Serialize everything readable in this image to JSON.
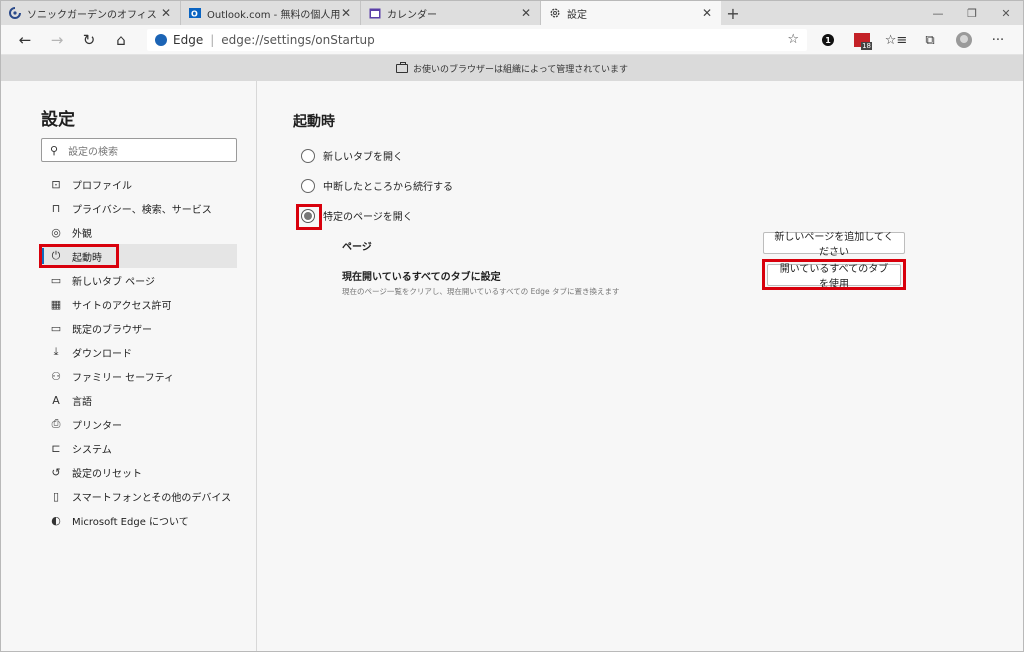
{
  "tabs": [
    {
      "title": "ソニックガーデンのオフィス",
      "favicon": "remotty-icon"
    },
    {
      "title": "Outlook.com - 無料の個人用メール",
      "favicon": "outlook-icon"
    },
    {
      "title": "カレンダー",
      "favicon": "calendar-icon"
    },
    {
      "title": "設定",
      "favicon": "gear-icon"
    }
  ],
  "address_bar": {
    "site_label": "Edge",
    "url": "edge://settings/onStartup"
  },
  "toolbar_badges": {
    "notification_count": "1",
    "calendar_day": "18"
  },
  "managed_notice": "お使いのブラウザーは組織によって管理されています",
  "sidebar": {
    "title": "設定",
    "search_placeholder": "設定の検索",
    "items": [
      {
        "label": "プロファイル",
        "icon": "profile-icon"
      },
      {
        "label": "プライバシー、検索、サービス",
        "icon": "lock-icon"
      },
      {
        "label": "外観",
        "icon": "palette-icon"
      },
      {
        "label": "起動時",
        "icon": "power-icon",
        "active": true
      },
      {
        "label": "新しいタブ ページ",
        "icon": "newtab-icon"
      },
      {
        "label": "サイトのアクセス許可",
        "icon": "site-permissions-icon"
      },
      {
        "label": "既定のブラウザー",
        "icon": "browser-icon"
      },
      {
        "label": "ダウンロード",
        "icon": "download-icon"
      },
      {
        "label": "ファミリー セーフティ",
        "icon": "family-icon"
      },
      {
        "label": "言語",
        "icon": "language-icon"
      },
      {
        "label": "プリンター",
        "icon": "printer-icon"
      },
      {
        "label": "システム",
        "icon": "laptop-icon"
      },
      {
        "label": "設定のリセット",
        "icon": "reset-icon"
      },
      {
        "label": "スマートフォンとその他のデバイス",
        "icon": "phone-icon"
      },
      {
        "label": "Microsoft Edge について",
        "icon": "edge-icon"
      }
    ]
  },
  "main": {
    "title": "起動時",
    "options": [
      {
        "label": "新しいタブを開く",
        "checked": false
      },
      {
        "label": "中断したところから続行する",
        "checked": false
      },
      {
        "label": "特定のページを開く",
        "checked": true
      }
    ],
    "pages_label": "ページ",
    "add_page_button": "新しいページを追加してください",
    "set_current_label": "現在開いているすべてのタブに設定",
    "set_current_desc": "現在のページ一覧をクリアし、現在開いているすべての Edge タブに置き換えます",
    "use_all_tabs_button": "開いているすべてのタブを使用"
  },
  "colors": {
    "highlight": "#d8000c",
    "active_indicator": "#0f6cbd"
  }
}
